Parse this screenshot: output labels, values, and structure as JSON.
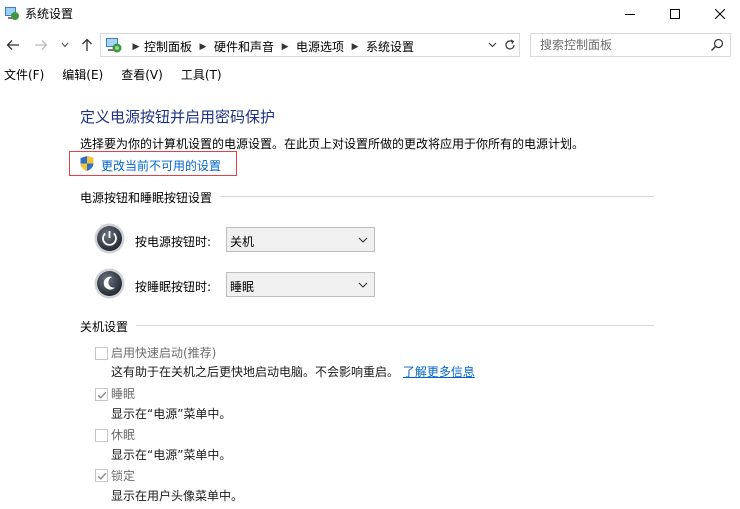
{
  "window": {
    "title": "系统设置",
    "controls": {
      "minimize": "minimize",
      "maximize": "maximize",
      "close": "close"
    }
  },
  "nav": {
    "breadcrumb": [
      "控制面板",
      "硬件和声音",
      "电源选项",
      "系统设置"
    ]
  },
  "search": {
    "placeholder": "搜索控制面板"
  },
  "menu": {
    "items": [
      "文件(F)",
      "编辑(E)",
      "查看(V)",
      "工具(T)"
    ]
  },
  "page": {
    "title": "定义电源按钮并启用密码保护",
    "description": "选择要为你的计算机设置的电源设置。在此页上对设置所做的更改将应用于你所有的电源计划。",
    "change_settings_link": "更改当前不可用的设置"
  },
  "buttons_section": {
    "header": "电源按钮和睡眠按钮设置",
    "power_button": {
      "label": "按电源按钮时:",
      "value": "关机"
    },
    "sleep_button": {
      "label": "按睡眠按钮时:",
      "value": "睡眠"
    }
  },
  "shutdown_section": {
    "header": "关机设置",
    "options": [
      {
        "label": "启用快速启动(推荐)",
        "checked": false,
        "desc": "这有助于在关机之后更快地启动电脑。不会影响重启。",
        "link": "了解更多信息"
      },
      {
        "label": "睡眠",
        "checked": true,
        "desc": "显示在“电源”菜单中。"
      },
      {
        "label": "休眠",
        "checked": false,
        "desc": "显示在“电源”菜单中。"
      },
      {
        "label": "锁定",
        "checked": true,
        "desc": "显示在用户头像菜单中。"
      }
    ]
  },
  "colors": {
    "title_blue": "#1e3287",
    "link_blue": "#0066cc",
    "highlight_red": "#e04343"
  }
}
